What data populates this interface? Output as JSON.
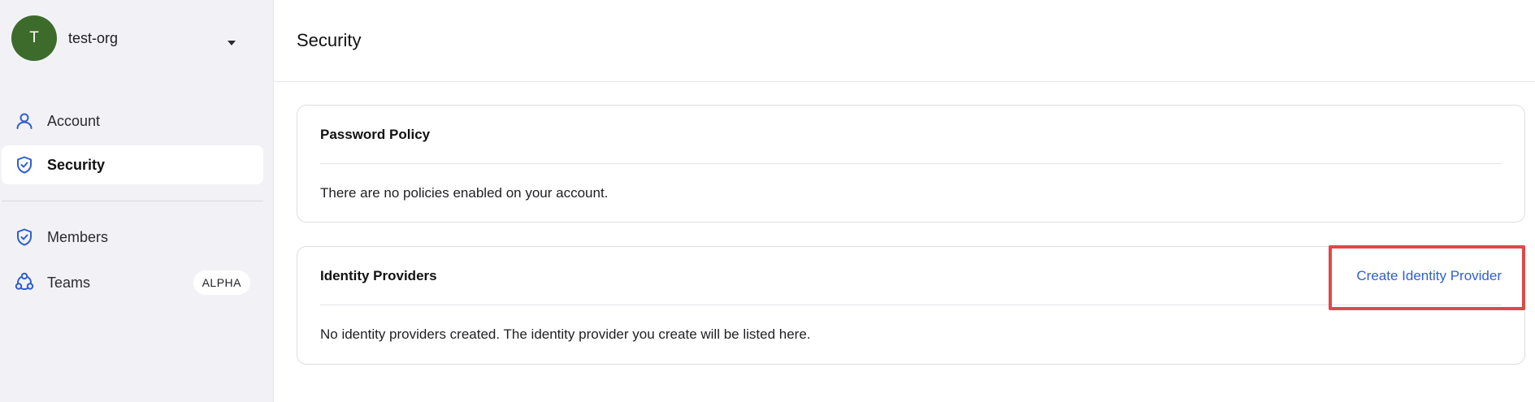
{
  "org": {
    "avatar_letter": "T",
    "name": "test-org",
    "avatar_color": "#3d6b2b"
  },
  "sidebar": {
    "items": [
      {
        "label": "Account",
        "icon": "user-icon",
        "active": false
      },
      {
        "label": "Security",
        "icon": "shield-check-icon",
        "active": true
      },
      {
        "label": "Members",
        "icon": "shield-check-icon",
        "active": false
      },
      {
        "label": "Teams",
        "icon": "team-icon",
        "active": false,
        "badge": "ALPHA"
      }
    ]
  },
  "header": {
    "title": "Security"
  },
  "password_policy": {
    "title": "Password Policy",
    "message": "There are no policies enabled on your account."
  },
  "identity_providers": {
    "title": "Identity Providers",
    "action_label": "Create Identity Provider",
    "message": "No identity providers created. The identity provider you create will be listed here."
  },
  "colors": {
    "accent": "#2f5fd0",
    "highlight": "#e04848",
    "sidebar_bg": "#f2f2f6"
  }
}
